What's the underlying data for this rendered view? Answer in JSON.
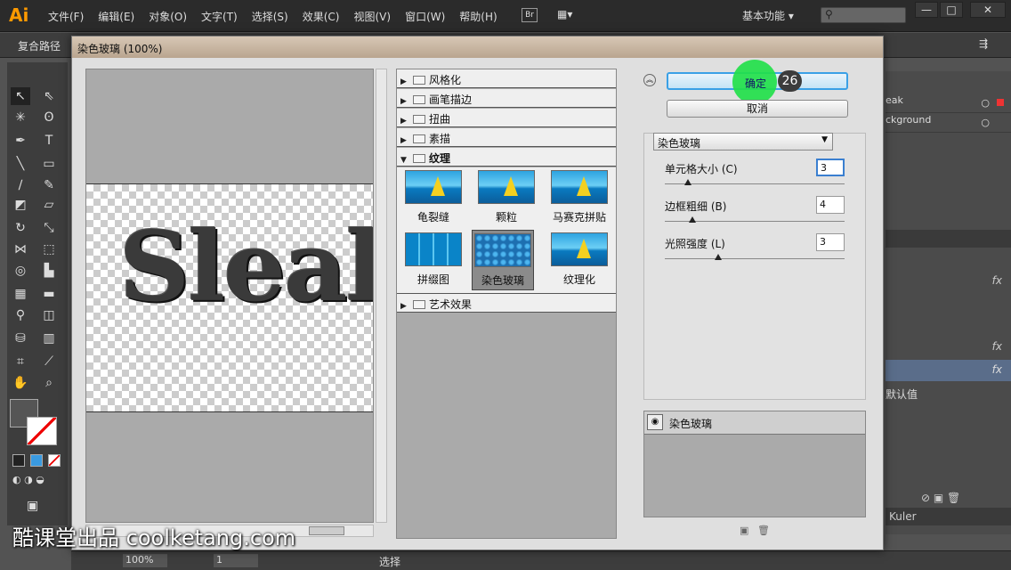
{
  "app": {
    "logo": "Ai",
    "menus": [
      "文件(F)",
      "编辑(E)",
      "对象(O)",
      "文字(T)",
      "选择(S)",
      "效果(C)",
      "视图(V)",
      "窗口(W)",
      "帮助(H)"
    ],
    "bridge": "Br",
    "workspace": "基本功能",
    "window_buttons": [
      "—",
      "□",
      "✕"
    ]
  },
  "control_bar": {
    "label": "复合路径"
  },
  "dialog": {
    "title": "染色玻璃 (100%)",
    "preview_text": "Sleak",
    "categories": [
      {
        "label": "风格化"
      },
      {
        "label": "画笔描边"
      },
      {
        "label": "扭曲"
      },
      {
        "label": "素描"
      },
      {
        "label": "纹理"
      },
      {
        "label": "艺术效果"
      }
    ],
    "texture_thumbs": [
      {
        "label": "龟裂缝"
      },
      {
        "label": "颗粒"
      },
      {
        "label": "马赛克拼贴"
      },
      {
        "label": "拼缀图"
      },
      {
        "label": "染色玻璃"
      },
      {
        "label": "纹理化"
      }
    ],
    "ok_label": "确定",
    "cancel_label": "取消",
    "step_badge": "26",
    "filter_select": "染色玻璃",
    "params": [
      {
        "label": "单元格大小 (C)",
        "value": "3",
        "fraction": 0.13
      },
      {
        "label": "边框粗细 (B)",
        "value": "4",
        "fraction": 0.15
      },
      {
        "label": "光照强度 (L)",
        "value": "3",
        "fraction": 0.3
      }
    ],
    "effect_layers": [
      {
        "label": "染色玻璃"
      }
    ]
  },
  "right_panel": {
    "layer_names": [
      "eak",
      "ckground"
    ],
    "default_label": "默认值",
    "kuler": "Kuler"
  },
  "status": {
    "zoom": "100%",
    "artboard": "1",
    "mode": "选择"
  },
  "watermark": "酷课堂出品 coolketang.com",
  "colors": {
    "ok_highlight": "#22e04a",
    "accent": "#3aa0e6"
  }
}
